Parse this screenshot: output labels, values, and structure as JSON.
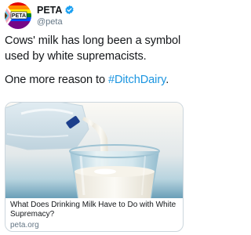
{
  "tweet": {
    "author": {
      "display_name": "PETA",
      "handle": "@peta",
      "verified": true,
      "avatar_icon": "rainbow-flag-peta-logo-icon",
      "avatar_logo_text": "PETA"
    },
    "text": {
      "line1": "Cows' milk has long been a symbol used by white supremacists.",
      "line2_prefix": "One more reason to ",
      "hashtag": "#DitchDairy",
      "line2_suffix": "."
    }
  },
  "link_card": {
    "image_icon": "milk-pouring-into-glass-image",
    "title": "What Does Drinking Milk Have to Do with White Supremacy?",
    "domain": "peta.org"
  },
  "colors": {
    "text": "#14171a",
    "secondary": "#657786",
    "link": "#1b95e0",
    "verified": "#1da1f2",
    "card_border": "#ccd6dd"
  }
}
